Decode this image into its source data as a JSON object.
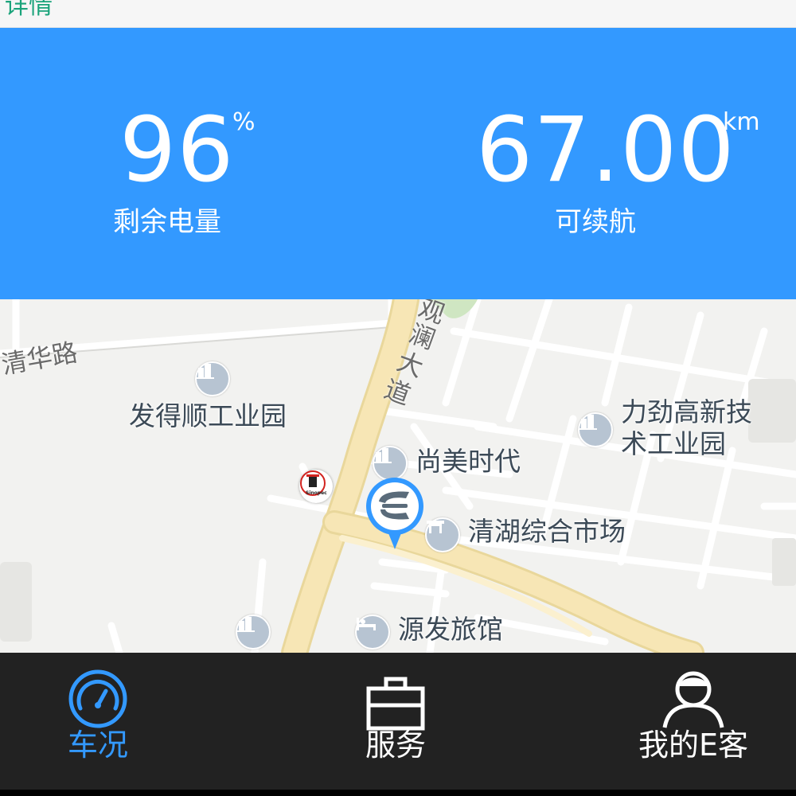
{
  "top_bar": {
    "title_fragment": "详情"
  },
  "battery": {
    "value": "96",
    "unit": "%",
    "label": "剩余电量",
    "level_percent": 96
  },
  "range": {
    "value": "67.00",
    "unit": "km",
    "label": "可续航"
  },
  "map": {
    "roads": {
      "qinghua_road": "清华路",
      "guanlan_avenue_1": "观",
      "guanlan_avenue_2": "澜",
      "guanlan_avenue_3": "大",
      "guanlan_avenue_4": "道"
    },
    "pois": {
      "fadeshun": "发得顺工业园",
      "lijin_line1": "力劲高新技",
      "lijin_line2": "术工业园",
      "shangmei": "尚美时代",
      "qinghu_market": "清湖综合市场",
      "yuanfa_hotel": "源发旅馆"
    },
    "gas_station_badge": "Sinopec",
    "colors": {
      "background": "#f2f2f0",
      "major_road": "#f7e6b5",
      "minor_road": "#ffffff",
      "poi_icon": "#b7c4d2",
      "marker": "#3399ff"
    }
  },
  "bottom_nav": {
    "items": [
      {
        "label": "车况",
        "icon": "speedometer-icon",
        "active": true
      },
      {
        "label": "服务",
        "icon": "briefcase-icon",
        "active": false
      },
      {
        "label": "我的E客",
        "icon": "user-icon",
        "active": false
      }
    ]
  },
  "colors": {
    "accent": "#3399ff",
    "nav_bg": "#222222",
    "title_green": "#1aa37a"
  }
}
